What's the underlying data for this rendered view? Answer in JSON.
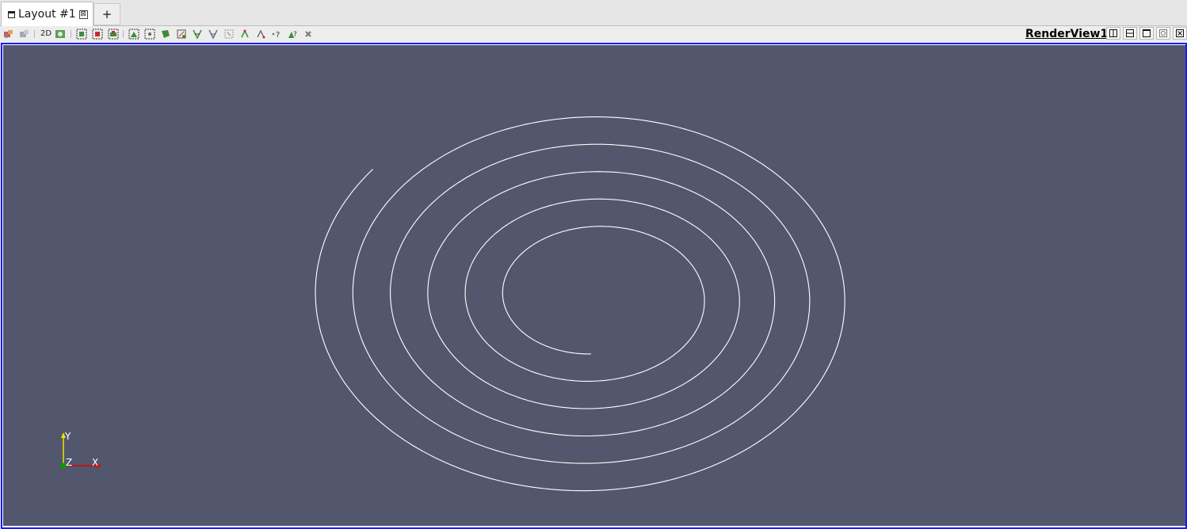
{
  "tabs": {
    "active_label": "Layout #1",
    "close_glyph": "⊠",
    "add_label": "+"
  },
  "toolbar": {
    "mode_2d_label": "2D",
    "icons": [
      "reset-camera-icon",
      "reset-camera-closest-icon",
      "toggle-2d-3d",
      "capture-screenshot-icon",
      "select-surface-cells-icon",
      "select-surface-points-icon",
      "select-frustum-cells-icon",
      "select-frustum-points-icon",
      "select-polygon-cells-icon",
      "select-polygon-points-icon",
      "select-block-icon",
      "interactive-select-cells-icon",
      "interactive-select-points-icon",
      "hover-points-icon",
      "hover-cells-icon",
      "grow-selection-icon",
      "shrink-selection-icon",
      "clear-selection-icon"
    ]
  },
  "view": {
    "title": "RenderView1",
    "buttons": [
      "split-horizontal-icon",
      "split-vertical-icon",
      "maximize-icon",
      "restore-icon",
      "close-view-icon"
    ]
  },
  "scene": {
    "background_color": "#52576e",
    "curve_color": "#ffffff",
    "frame_color": "#1a1aff",
    "orientation_axes": {
      "x_label": "X",
      "y_label": "Y",
      "z_label": "Z",
      "x_color": "#e00000",
      "y_color": "#f0e000",
      "z_color": "#00a000"
    }
  }
}
